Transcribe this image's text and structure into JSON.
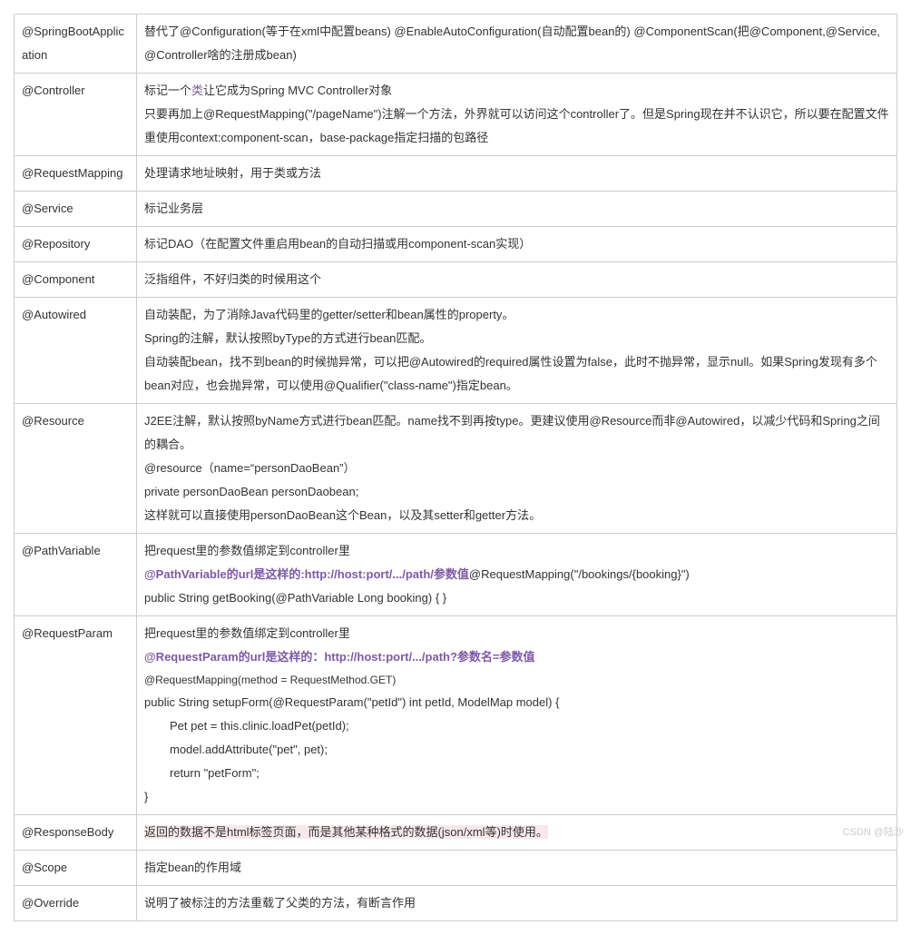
{
  "watermark": "CSDN @陆沙",
  "rows": [
    {
      "annotation": "@SpringBootApplication",
      "desc_html": "替代了@Configuration(等于在xml中配置beans) @EnableAutoConfiguration(自动配置bean的) @ComponentScan(把@Component,@Service, @Controller啥的注册成bean)"
    },
    {
      "annotation": "@Controller",
      "lines": [
        {
          "type": "mixed",
          "parts": [
            {
              "text": "标记一个"
            },
            {
              "text": "类",
              "class": "link"
            },
            {
              "text": "让它成为Spring MVC Controller对象"
            }
          ]
        },
        {
          "type": "plain",
          "text": "只要再加上@RequestMapping(\"/pageName\")注解一个方法，外界就可以访问这个controller了。但是Spring现在并不认识它，所以要在配置文件重使用context:component-scan，base-package指定扫描的包路径"
        }
      ]
    },
    {
      "annotation": "@RequestMapping",
      "desc_html": "处理请求地址映射，用于类或方法"
    },
    {
      "annotation": "@Service",
      "desc_html": "标记业务层"
    },
    {
      "annotation": "@Repository",
      "desc_html": "标记DAO（在配置文件重启用bean的自动扫描或用component-scan实现）"
    },
    {
      "annotation": "@Component",
      "desc_html": "泛指组件，不好归类的时候用这个"
    },
    {
      "annotation": "@Autowired",
      "lines": [
        {
          "type": "plain",
          "text": "自动装配，为了消除Java代码里的getter/setter和bean属性的property。"
        },
        {
          "type": "plain",
          "text": "Spring的注解，默认按照byType的方式进行bean匹配。"
        },
        {
          "type": "plain",
          "text": "自动装配bean，找不到bean的时候抛异常，可以把@Autowired的required属性设置为false，此时不抛异常，显示null。如果Spring发现有多个bean对应，也会抛异常，可以使用@Qualifier(\"class-name\")指定bean。"
        }
      ]
    },
    {
      "annotation": "@Resource",
      "lines": [
        {
          "type": "plain",
          "text": "J2EE注解，默认按照byName方式进行bean匹配。name找不到再按type。更建议使用@Resource而非@Autowired，以减少代码和Spring之间的耦合。"
        },
        {
          "type": "plain",
          "text": "@resource（name=“personDaoBean”）"
        },
        {
          "type": "plain",
          "text": "private personDaoBean personDaobean;"
        },
        {
          "type": "plain",
          "text": "这样就可以直接使用personDaoBean这个Bean，以及其setter和getter方法。"
        }
      ]
    },
    {
      "annotation": "@PathVariable",
      "lines": [
        {
          "type": "plain",
          "text": "把request里的参数值绑定到controller里"
        },
        {
          "type": "mixed",
          "parts": [
            {
              "text": "@PathVariable的url是这样的:http://host:port/.../path/参数值",
              "class": "purple-bold"
            },
            {
              "text": "@RequestMapping(\"/bookings/{booking}\")"
            }
          ]
        },
        {
          "type": "plain",
          "text": "public String getBooking(@PathVariable Long booking) { }"
        }
      ]
    },
    {
      "annotation": "@RequestParam",
      "lines": [
        {
          "type": "plain",
          "text": "把request里的参数值绑定到controller里"
        },
        {
          "type": "styled",
          "text": "@RequestParam的url是这样的：http://host:port/.../path?参数名=参数值",
          "class": "purple-bold"
        },
        {
          "type": "styled",
          "text": "@RequestMapping(method = RequestMethod.GET)",
          "class": "code-line"
        },
        {
          "type": "plain",
          "text": "public String setupForm(@RequestParam(\"petId\") int petId, ModelMap model) {"
        },
        {
          "type": "indent",
          "text": "Pet pet = this.clinic.loadPet(petId);"
        },
        {
          "type": "indent",
          "text": "model.addAttribute(\"pet\", pet);"
        },
        {
          "type": "indent",
          "text": "return \"petForm\";"
        },
        {
          "type": "plain",
          "text": "}"
        }
      ]
    },
    {
      "annotation": "@ResponseBody",
      "highlight": true,
      "desc_html": "返回的数据不是html标签页面，而是其他某种格式的数据(json/xml等)时使用。"
    },
    {
      "annotation": "@Scope",
      "desc_html": "指定bean的作用域"
    },
    {
      "annotation": "@Override",
      "desc_html": "说明了被标注的方法重载了父类的方法，有断言作用"
    }
  ]
}
